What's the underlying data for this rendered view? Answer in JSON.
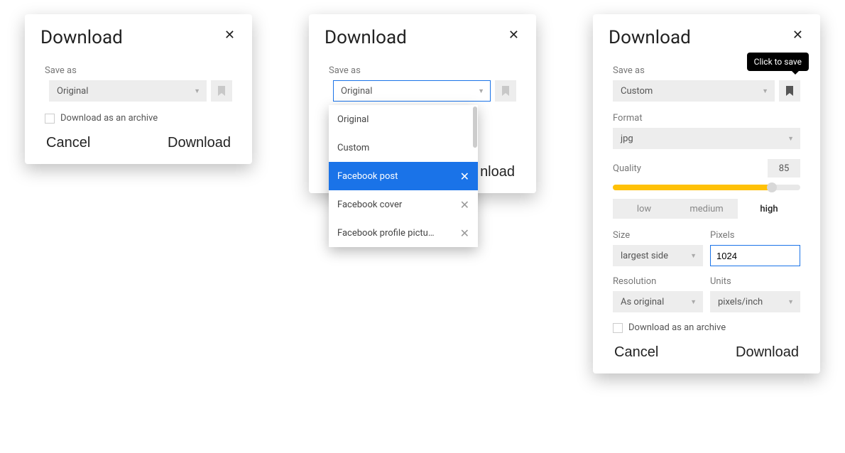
{
  "dialog1": {
    "title": "Download",
    "save_as_label": "Save as",
    "save_as_value": "Original",
    "archive_label": "Download as an archive",
    "cancel": "Cancel",
    "download": "Download"
  },
  "dialog2": {
    "title": "Download",
    "save_as_label": "Save as",
    "save_as_value": "Original",
    "options": [
      {
        "label": "Original",
        "removable": false
      },
      {
        "label": "Custom",
        "removable": false
      },
      {
        "label": "Facebook post",
        "removable": true,
        "highlight": true
      },
      {
        "label": "Facebook cover",
        "removable": true
      },
      {
        "label": "Facebook profile pictu…",
        "removable": true
      }
    ],
    "download": "nload"
  },
  "dialog3": {
    "title": "Download",
    "tooltip": "Click to save",
    "save_as_label": "Save as",
    "save_as_value": "Custom",
    "format_label": "Format",
    "format_value": "jpg",
    "quality_label": "Quality",
    "quality_value": "85",
    "presets": {
      "low": "low",
      "medium": "medium",
      "high": "high"
    },
    "size_label": "Size",
    "size_value": "largest side",
    "pixels_label": "Pixels",
    "pixels_value": "1024",
    "resolution_label": "Resolution",
    "resolution_value": "As original",
    "units_label": "Units",
    "units_value": "pixels/inch",
    "archive_label": "Download as an archive",
    "cancel": "Cancel",
    "download": "Download"
  }
}
